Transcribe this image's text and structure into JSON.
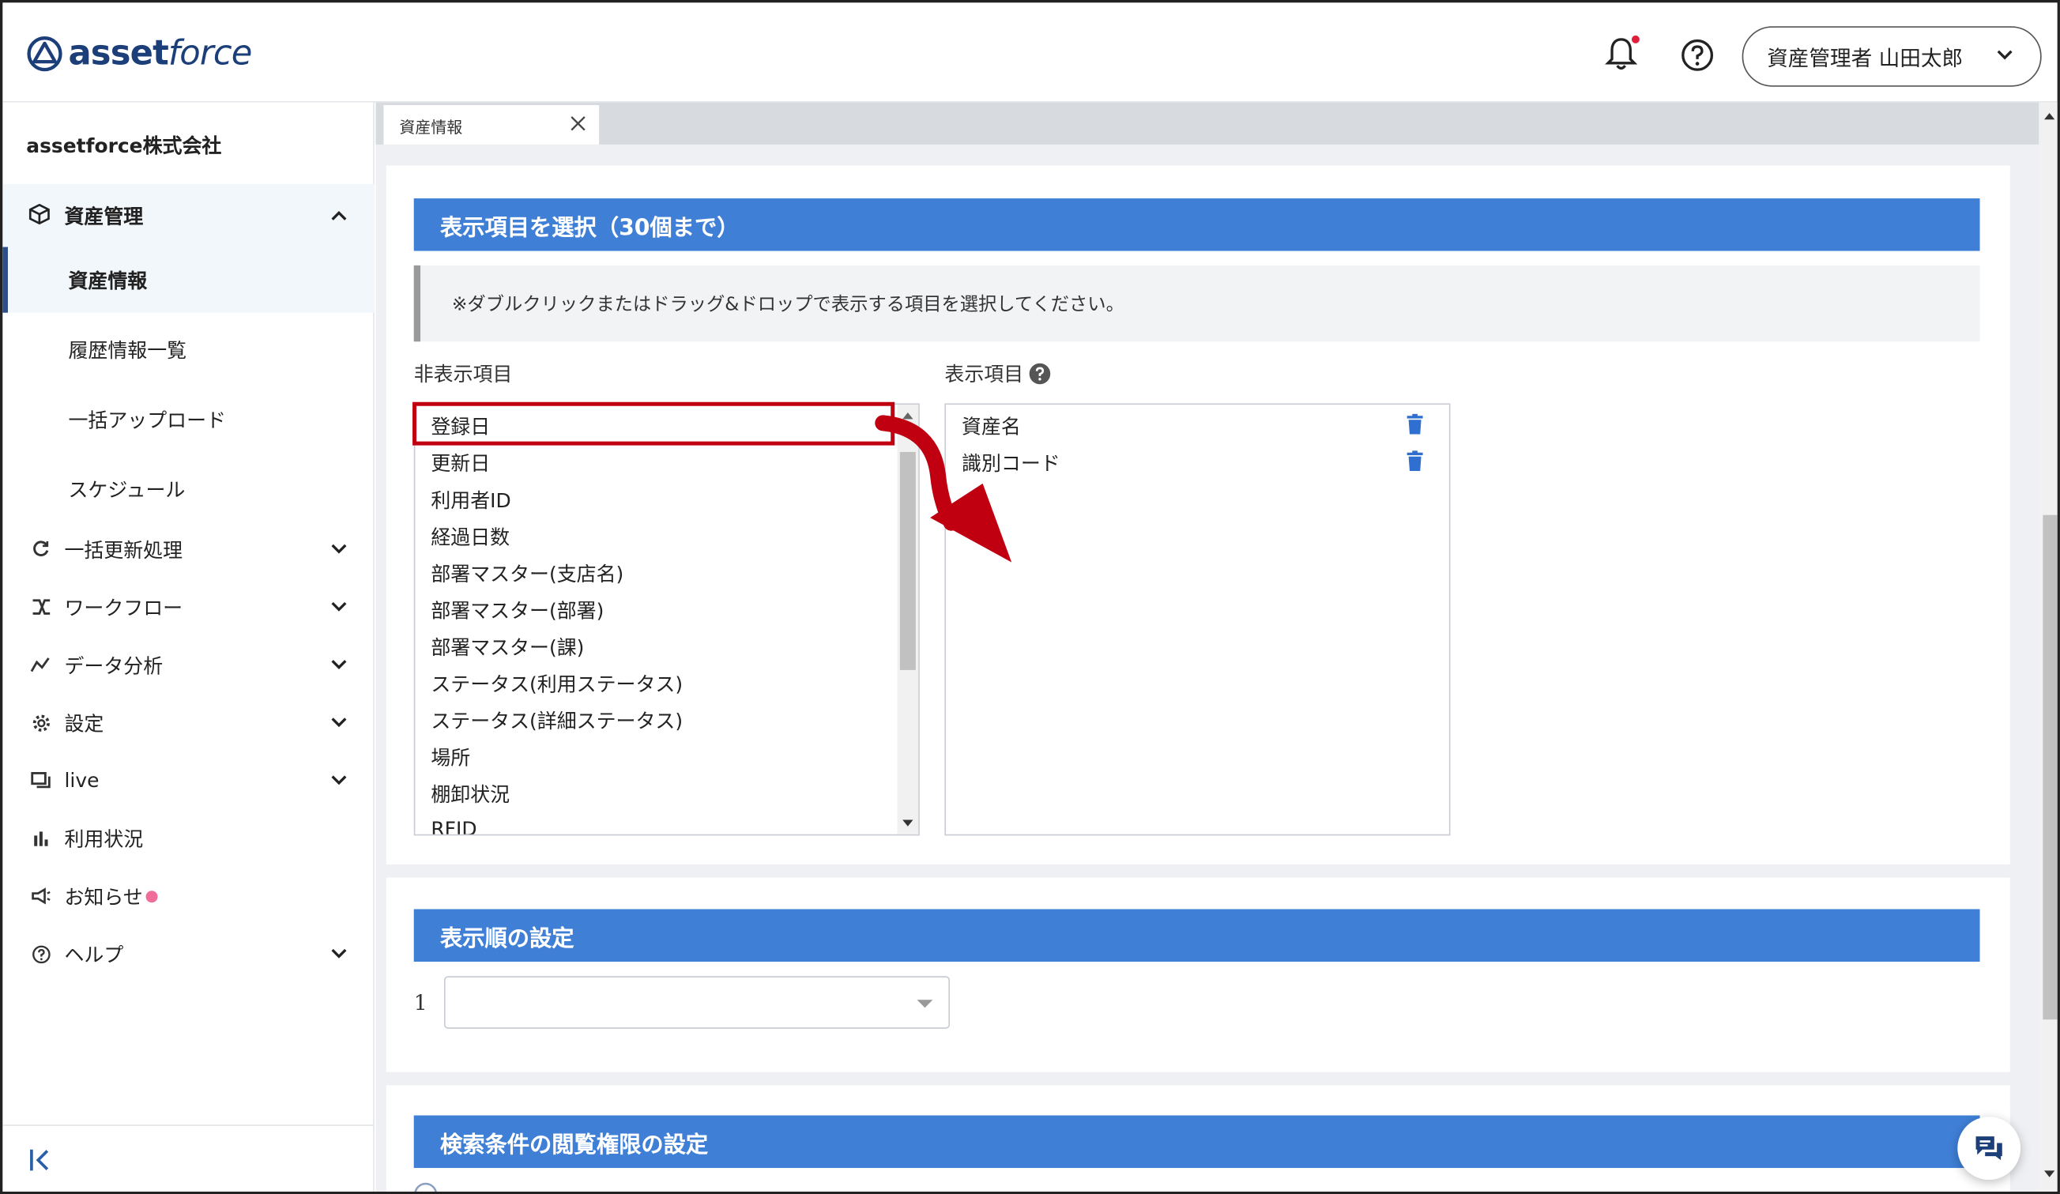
{
  "brand": {
    "logo_text_a": "asset",
    "logo_text_b": "force"
  },
  "header": {
    "user_label": "資産管理者 山田太郎"
  },
  "sidebar": {
    "company": "assetforce株式会社",
    "group_label": "資産管理",
    "sub_items": [
      "資産情報",
      "履歴情報一覧",
      "一括アップロード",
      "スケジュール"
    ],
    "items": [
      {
        "label": "一括更新処理",
        "icon": "refresh-icon"
      },
      {
        "label": "ワークフロー",
        "icon": "workflow-icon"
      },
      {
        "label": "データ分析",
        "icon": "analytics-icon"
      },
      {
        "label": "設定",
        "icon": "gear-icon"
      },
      {
        "label": "live",
        "icon": "live-icon"
      },
      {
        "label": "利用状況",
        "icon": "bar-chart-icon"
      },
      {
        "label": "お知らせ",
        "icon": "megaphone-icon"
      },
      {
        "label": "ヘルプ",
        "icon": "help-icon"
      }
    ]
  },
  "tab": {
    "label": "資産情報"
  },
  "select_section": {
    "title": "表示項目を選択（30個まで）",
    "note": "※ダブルクリックまたはドラッグ&ドロップで表示する項目を選択してください。",
    "hidden_label": "非表示項目",
    "shown_label": "表示項目",
    "hidden_items": [
      "登録日",
      "更新日",
      "利用者ID",
      "経過日数",
      "部署マスター(支店名)",
      "部署マスター(部署)",
      "部署マスター(課)",
      "ステータス(利用ステータス)",
      "ステータス(詳細ステータス)",
      "場所",
      "棚卸状況",
      "RFID"
    ],
    "shown_items": [
      "資産名",
      "識別コード"
    ]
  },
  "order_section": {
    "title": "表示順の設定",
    "row_number": "1",
    "value": ""
  },
  "permission_section": {
    "title": "検索条件の閲覧権限の設定"
  },
  "colors": {
    "accent": "#3f7fd6",
    "highlight": "#c00010",
    "brand": "#1c3f7a"
  }
}
